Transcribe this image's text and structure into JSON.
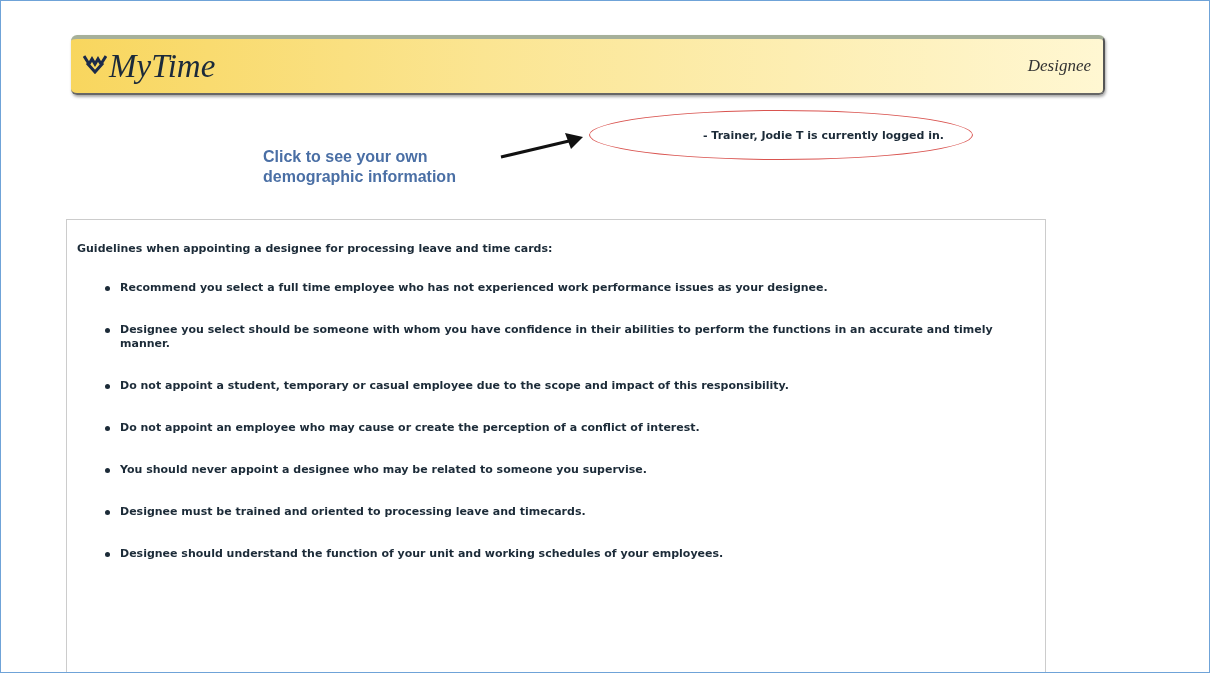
{
  "header": {
    "title": "MyTime",
    "page": "Designee"
  },
  "login_status": "- Trainer, Jodie T is currently logged in.",
  "callout": {
    "line1": "Click to see your own",
    "line2": "demographic information"
  },
  "guidelines": {
    "heading": "Guidelines when appointing a designee for processing leave and time cards:",
    "items": [
      "Recommend you select a full time employee who has not experienced work performance issues as your designee.",
      "Designee you select should be someone with whom you have confidence in their abilities to perform the functions in an accurate and timely manner.",
      "Do not appoint a student, temporary or casual employee due to the scope and impact of this responsibility.",
      "Do not appoint an employee who may cause or create the perception of a conflict of interest.",
      "You should never appoint a designee who may be related to someone you supervise.",
      "Designee must be trained and oriented to processing leave and timecards.",
      "Designee should understand the function of your unit and working schedules of your employees."
    ]
  }
}
